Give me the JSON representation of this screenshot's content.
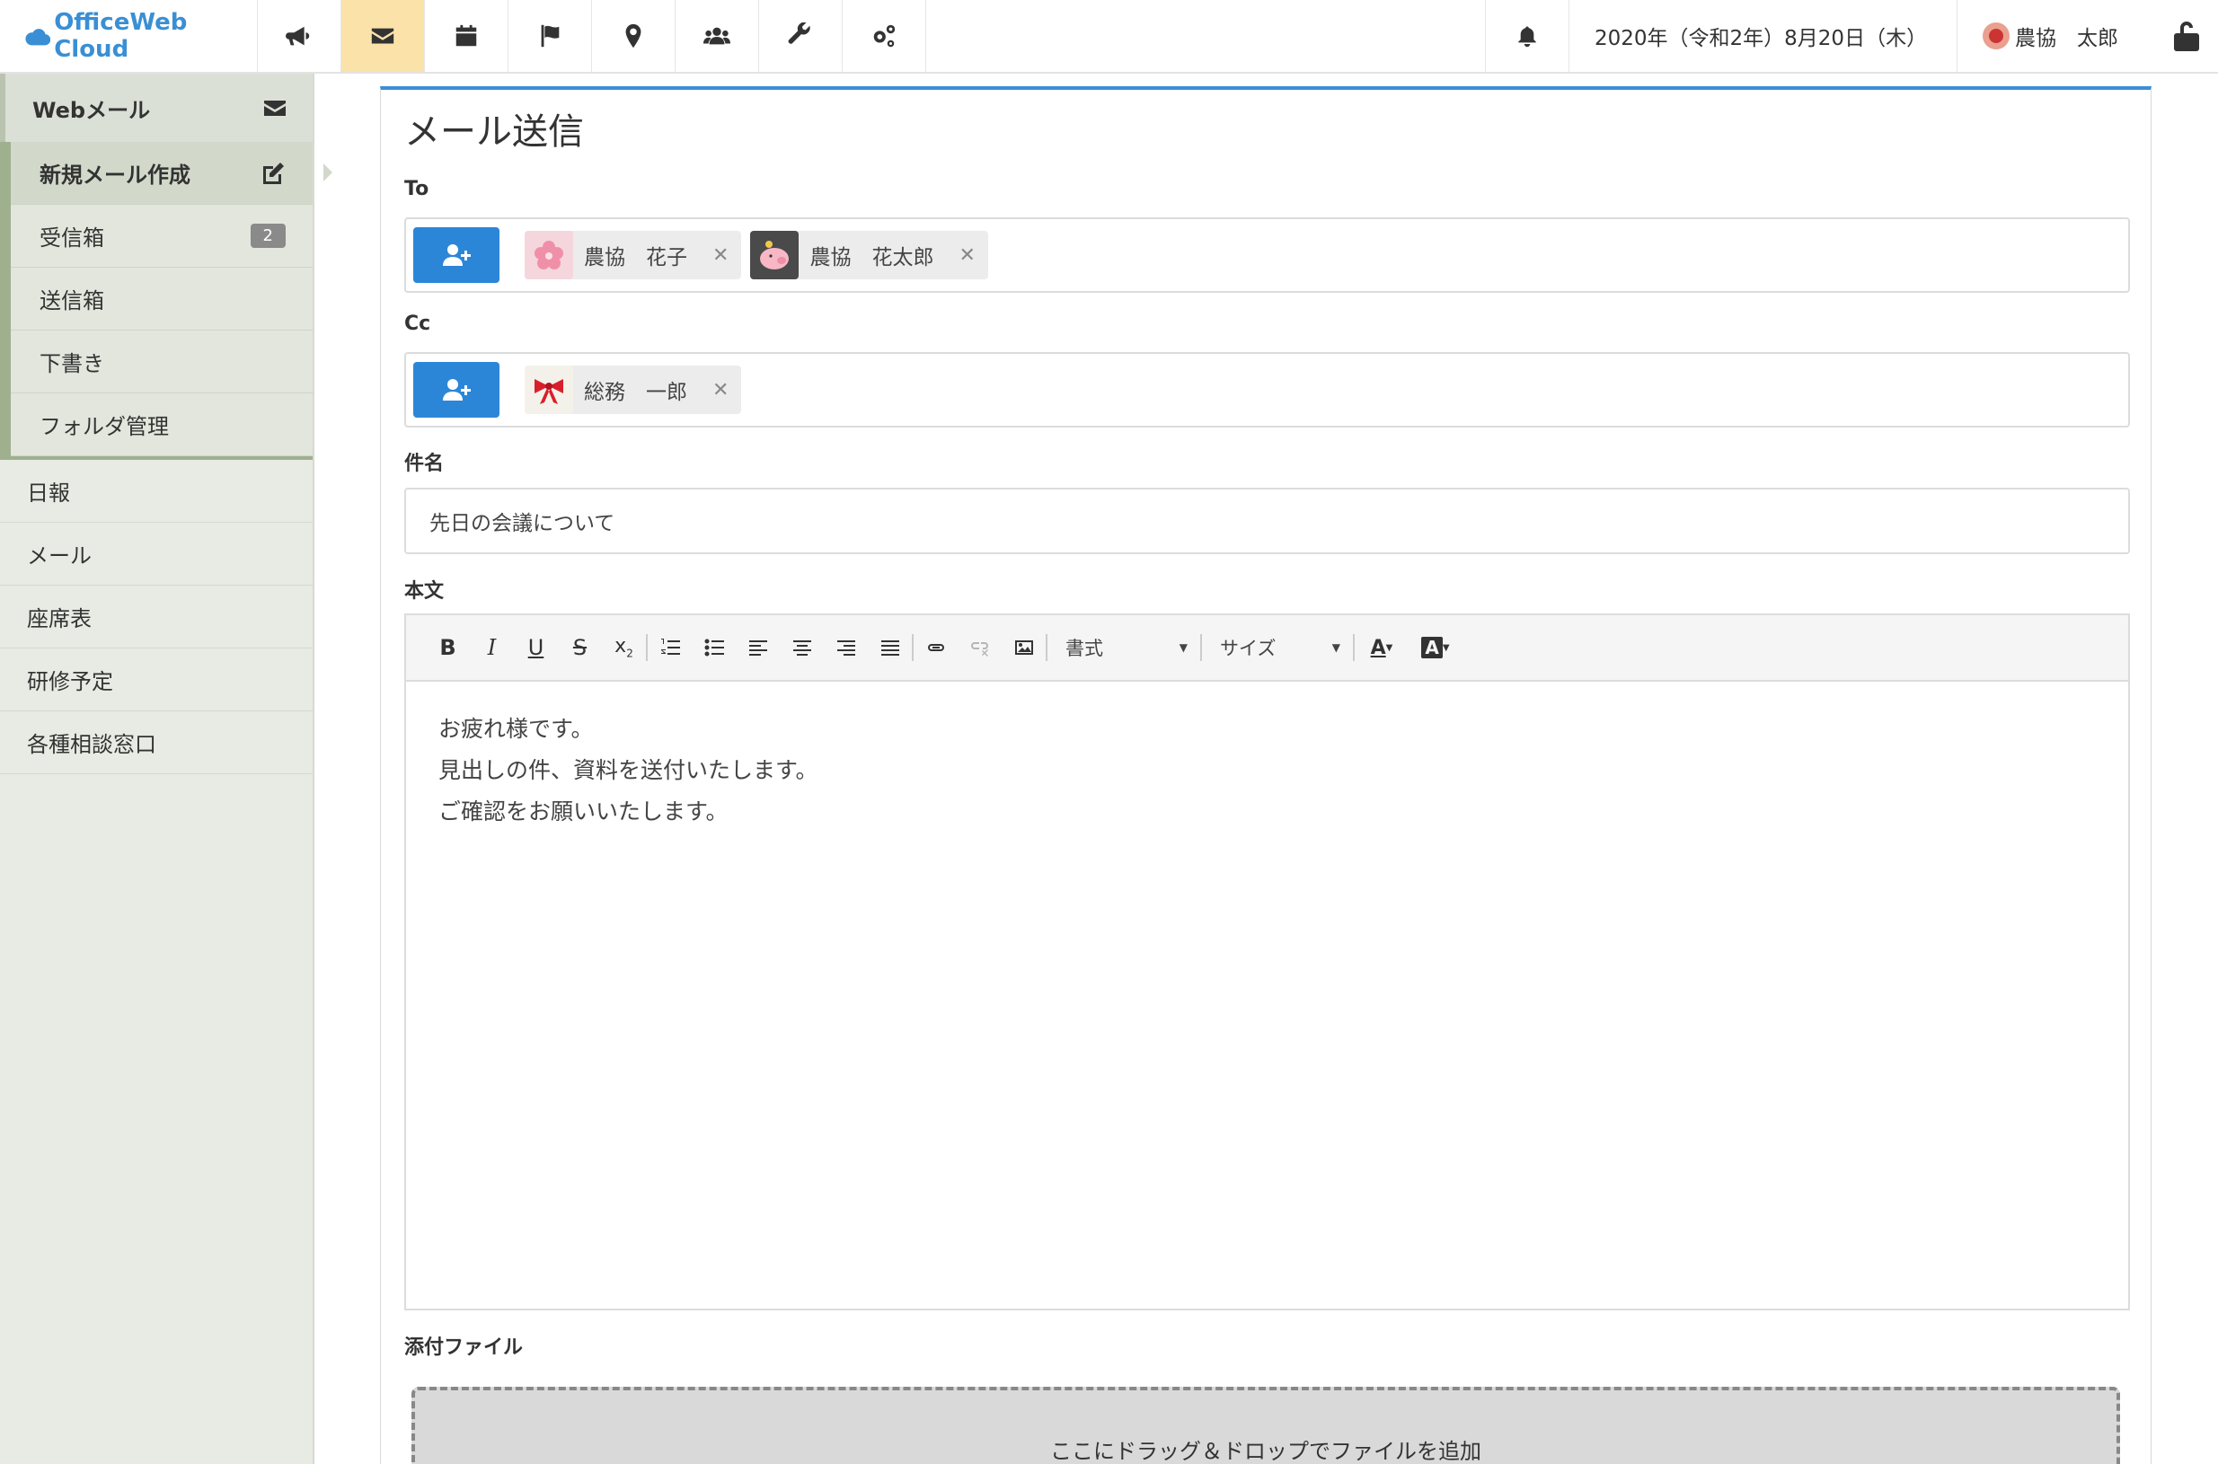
{
  "app": {
    "brand": "OfficeWeb Cloud"
  },
  "topbar": {
    "nav_icons": [
      "megaphone-icon",
      "envelope-icon",
      "calendar-icon",
      "flag-icon",
      "map-marker-icon",
      "users-icon",
      "wrench-icon",
      "cogs-icon"
    ],
    "active_nav": "envelope-icon",
    "date": "2020年（令和2年）8月20日（木）",
    "user_name": "農協　太郎"
  },
  "sidebar": {
    "header": "Webメール",
    "sub_items": [
      {
        "label": "新規メール作成",
        "active": true
      },
      {
        "label": "受信箱",
        "badge": "2"
      },
      {
        "label": "送信箱"
      },
      {
        "label": "下書き"
      },
      {
        "label": "フォルダ管理"
      }
    ],
    "items": [
      "日報",
      "メール",
      "座席表",
      "研修予定",
      "各種相談窓口"
    ]
  },
  "main": {
    "title": "メール送信",
    "to_label": "To",
    "to_recipients": [
      {
        "name": "農協　花子",
        "avatar": "flower-avatar"
      },
      {
        "name": "農協　花太郎",
        "avatar": "pig-avatar"
      }
    ],
    "cc_label": "Cc",
    "cc_recipients": [
      {
        "name": "総務　一郎",
        "avatar": "ribbon-avatar"
      }
    ],
    "subject_label": "件名",
    "subject_value": "先日の会議について",
    "body_label": "本文",
    "toolbar": {
      "format_label": "書式",
      "size_label": "サイズ"
    },
    "body_lines": [
      "お疲れ様です。",
      "見出しの件、資料を送付いたします。",
      "ご確認をお願いいたします。"
    ],
    "attachment_label": "添付ファイル",
    "dropzone_text": "ここにドラッグ＆ドロップでファイルを追加"
  },
  "colors": {
    "accent": "#2c86d8",
    "active_nav": "#fbe2a9",
    "sidebar_bg": "#e8ebe3"
  }
}
